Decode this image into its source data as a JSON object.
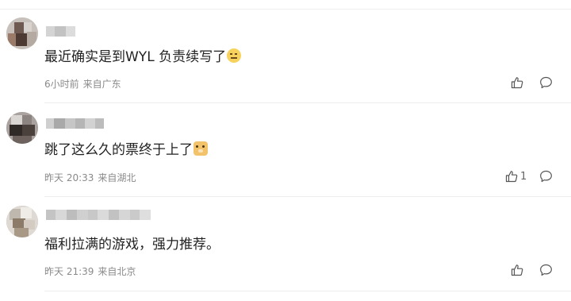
{
  "comments": [
    {
      "text": "最近确实是到WYL 负责续写了",
      "time": "6小时前",
      "location": "来自广东",
      "likes": null,
      "emoji": "thinking-face-emoji"
    },
    {
      "text": "跳了这么久的票终于上了",
      "time": "昨天 20:33",
      "location": "来自湖北",
      "likes": "1",
      "emoji": "doge-emoji"
    },
    {
      "text": "福利拉满的游戏，强力推荐。",
      "time": "昨天 21:39",
      "location": "来自北京",
      "likes": null,
      "emoji": null
    }
  ],
  "icons": {
    "like": "thumbs-up-icon",
    "reply": "comment-bubble-icon"
  },
  "colors": {
    "text": "#222222",
    "meta": "#8a8a8a",
    "divider": "#ededed"
  }
}
